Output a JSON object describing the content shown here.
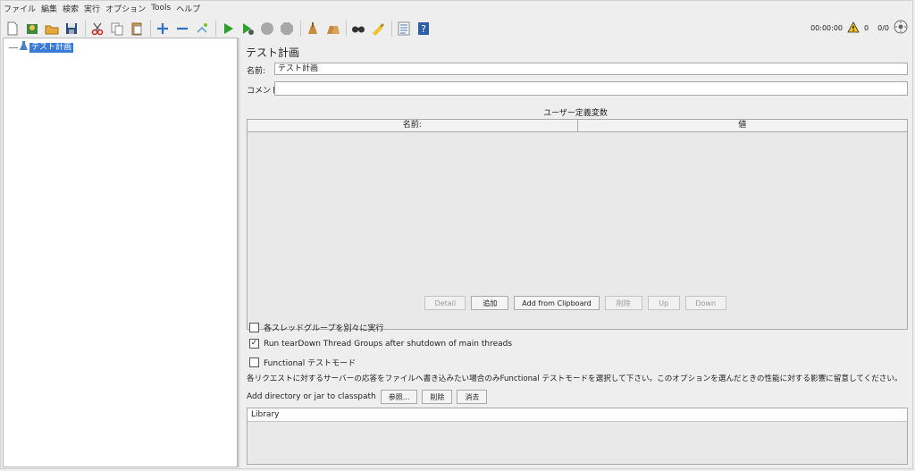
{
  "menu": {
    "items": [
      "ファイル",
      "編集",
      "検索",
      "実行",
      "オプション",
      "Tools",
      "ヘルプ"
    ]
  },
  "toolbar": {
    "icons": [
      "new-icon",
      "templates-icon",
      "open-icon",
      "save-icon",
      "cut-icon",
      "copy-icon",
      "paste-icon",
      "expand-icon",
      "collapse-icon",
      "toggle-icon",
      "start-icon",
      "start-no-pause-icon",
      "stop-icon",
      "shutdown-icon",
      "clear-icon",
      "clear-all-icon",
      "search-icon",
      "reset-search-icon",
      "function-helper-icon",
      "help-icon"
    ],
    "timer": "00:00:00",
    "warning_count": "0",
    "threads": "0/0"
  },
  "tree": {
    "root_label": "テスト計画"
  },
  "panel": {
    "title": "テスト計画",
    "name_label": "名前:",
    "name_value": "テスト計画",
    "comment_label": "コメント",
    "comment_value": "",
    "vars_title": "ユーザー定義変数",
    "col_name": "名前:",
    "col_value": "値",
    "buttons": {
      "detail": "Detail",
      "add": "追加",
      "add_clipboard": "Add from Clipboard",
      "delete": "削除",
      "up": "Up",
      "down": "Down"
    },
    "check_serial": {
      "label": "各スレッドグループを別々に実行",
      "checked": false
    },
    "check_teardown": {
      "label": "Run tearDown Thread Groups after shutdown of main threads",
      "checked": true
    },
    "check_functional": {
      "label": "Functional テストモード",
      "checked": false
    },
    "note": "各リクエストに対するサーバーの応答をファイルへ書き込みたい場合のみFunctional テストモードを選択して下さい。このオプションを選んだときの性能に対する影響に留意してください。",
    "classpath_label": "Add directory or jar to classpath",
    "classpath_buttons": {
      "browse": "参照...",
      "delete": "削除",
      "clear": "消去"
    },
    "library_header": "Library"
  },
  "colors": {
    "selection": "#3b7bd8",
    "background": "#eeeeee"
  }
}
